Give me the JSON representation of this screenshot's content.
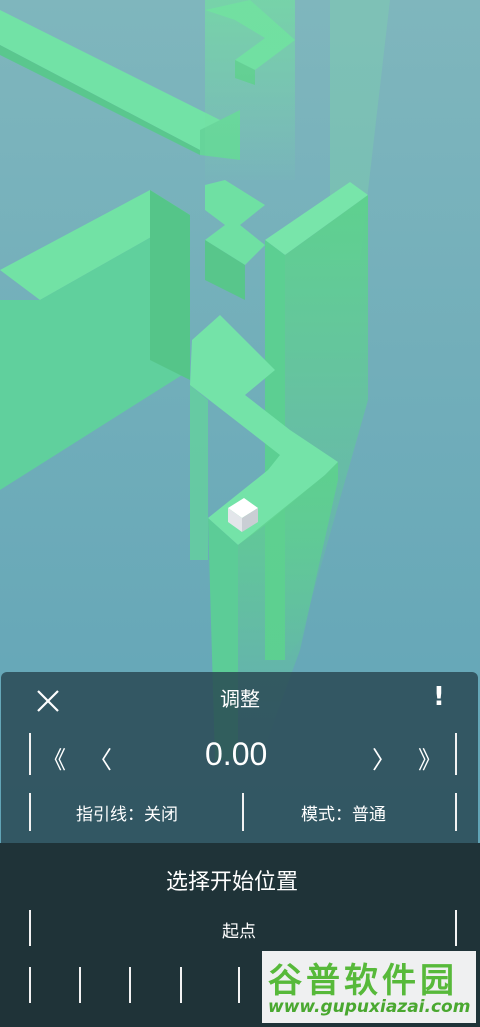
{
  "colors": {
    "sky": "#5fa3b3",
    "path_top": "#6fe39a",
    "path_side": "#5cc88a",
    "panel_bg": "#284650",
    "bottom_bg": "#1f3338",
    "watermark_green": "#57b93a"
  },
  "panel": {
    "title": "调整",
    "close_icon": "close-icon",
    "info_icon": "exclamation-icon",
    "info_label": "!",
    "fast_back_label": "《",
    "back_label": "〈",
    "value": "0.00",
    "forward_label": "〉",
    "fast_forward_label": "》",
    "guide_line_label": "指引线：关闭",
    "mode_label": "模式：普通"
  },
  "bottom": {
    "title": "选择开始位置",
    "start_label": "起点"
  },
  "watermark": {
    "title": "谷普软件园",
    "url": "www.gupuxiazai.com"
  }
}
